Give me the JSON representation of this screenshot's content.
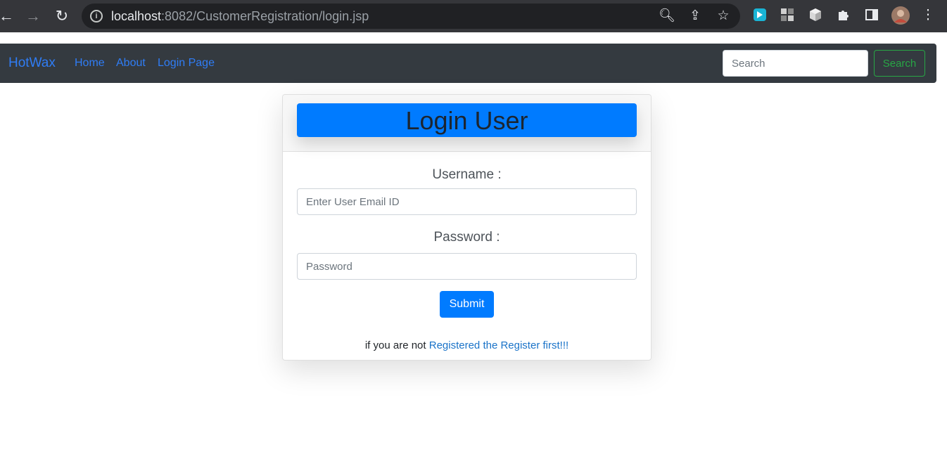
{
  "browser": {
    "url_host": "localhost",
    "url_rest": ":8082/CustomerRegistration/login.jsp",
    "icons": [
      "back-icon",
      "forward-icon",
      "reload-icon",
      "info-icon",
      "zoom-out-icon",
      "share-icon",
      "star-icon",
      "extension-bing-icon",
      "extension-grid-icon",
      "extension-cube-icon",
      "puzzle-icon",
      "sidebar-icon",
      "avatar",
      "kebab-menu-icon"
    ]
  },
  "navbar": {
    "brand": "HotWax",
    "links": [
      "Home",
      "About",
      "Login Page"
    ],
    "search_placeholder": "Search",
    "search_button": "Search",
    "link_color": "#2f7df6",
    "bg_color": "#343a40",
    "search_color": "#28a745"
  },
  "card": {
    "title": "Login User",
    "title_bg": "#007bff",
    "username_label": "Username :",
    "username_placeholder": "Enter User Email ID",
    "password_label": "Password :",
    "password_placeholder": "Password",
    "submit_label": "Submit",
    "footer_prefix": "if you are not",
    "footer_link": "Registered the Register first!!!"
  }
}
